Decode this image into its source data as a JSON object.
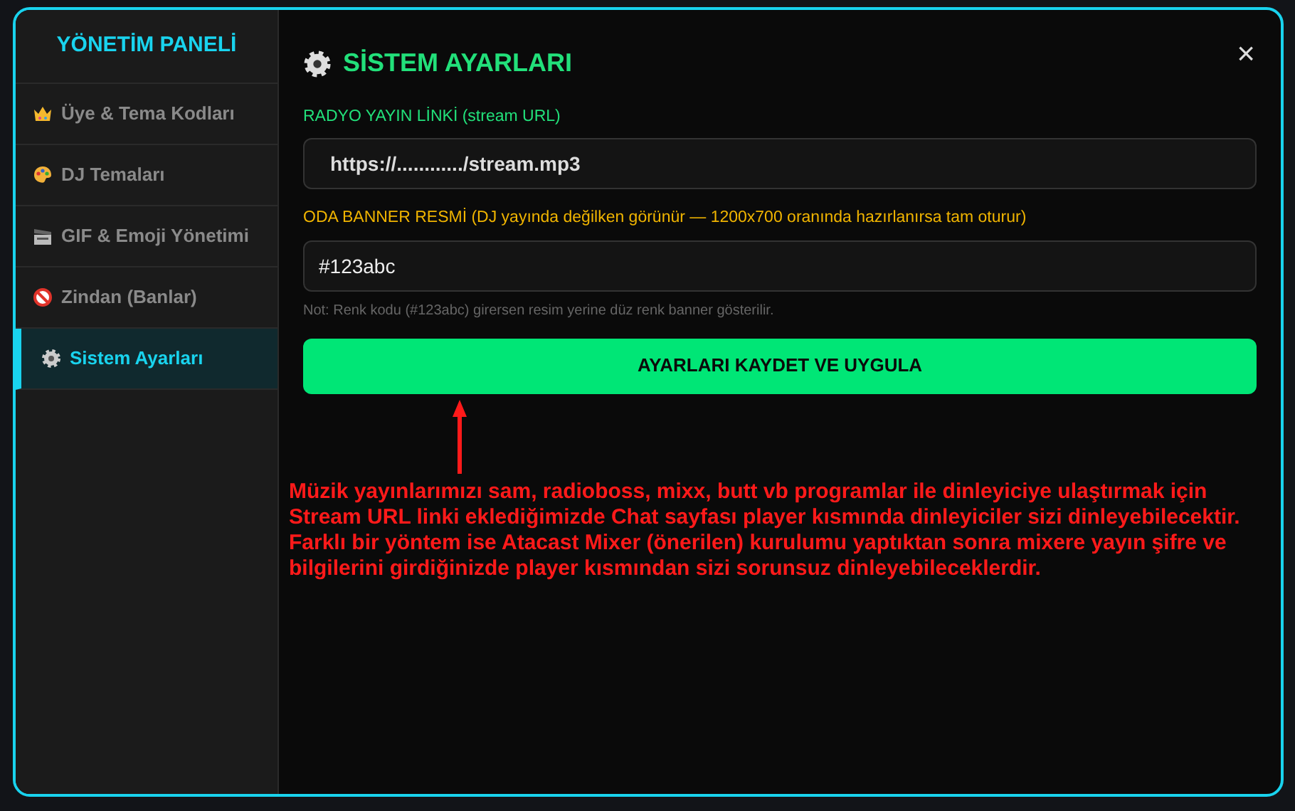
{
  "sidebar": {
    "title": "YÖNETİM PANELİ",
    "items": [
      {
        "label": "Üye & Tema Kodları",
        "kind": "crown",
        "selected": false
      },
      {
        "label": "DJ Temaları",
        "kind": "palette",
        "selected": false
      },
      {
        "label": "GIF & Emoji Yönetimi",
        "kind": "clapper",
        "selected": false
      },
      {
        "label": "Zindan (Banlar)",
        "kind": "ban",
        "selected": false
      },
      {
        "label": "Sistem Ayarları",
        "kind": "gear",
        "selected": true
      }
    ]
  },
  "panel": {
    "title": "SİSTEM AYARLARI",
    "close": "×",
    "fields": [
      {
        "label": "RADYO YAYIN LİNKİ (stream URL)",
        "value": "https://............/stream.mp3",
        "color": "#22e07a"
      },
      {
        "label": "ODA BANNER RESMİ (DJ yayında değilken görünür — 1200x700 oranında hazırlanırsa tam oturur)",
        "value": "#123abc",
        "color": "#f0b400"
      }
    ],
    "note": "Not: Renk kodu (#123abc) girersen resim yerine düz renk banner gösterilir.",
    "save_button": "AYARLARI KAYDET VE UYGULA"
  },
  "annotation": {
    "text": "Müzik yayınlarımızı sam, radioboss, mixx, butt vb programlar ile dinleyiciye ulaştırmak için Stream URL linki eklediğimizde Chat sayfası player kısmında dinleyiciler sizi dinleyebilecektir. Farklı bir yöntem ise Atacast Mixer (önerilen) kurulumu yaptıktan sonra mixere yayın şifre ve bilgilerini girdiğinizde player kısmından sizi sorunsuz dinleyebileceklerdir."
  }
}
